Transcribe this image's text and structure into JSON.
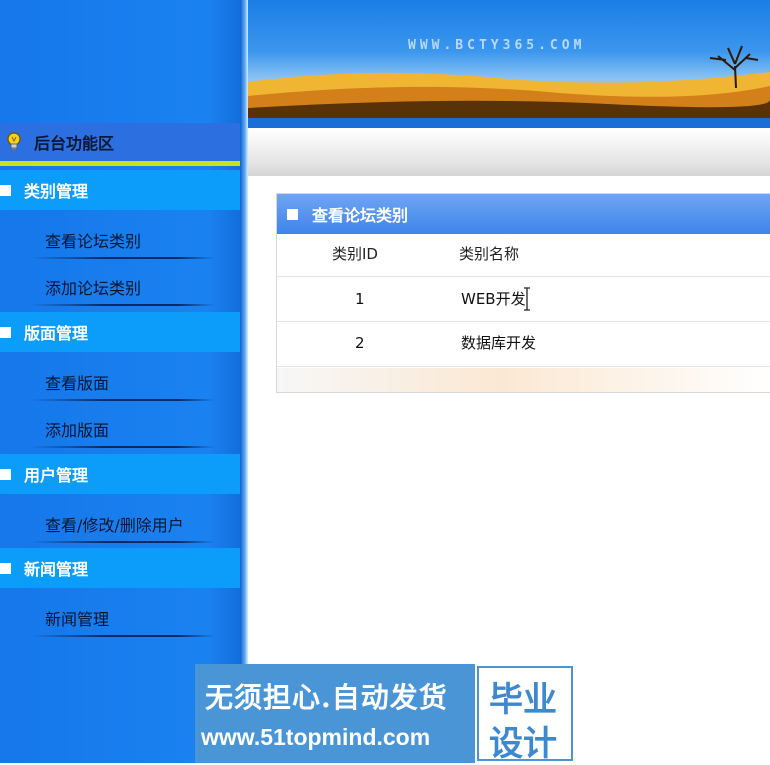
{
  "sidebar": {
    "header_label": "后台功能区",
    "header_icon": "lightbulb-icon",
    "sections": [
      {
        "label": "类别管理",
        "items": [
          "查看论坛类别",
          "添加论坛类别"
        ]
      },
      {
        "label": "版面管理",
        "items": [
          "查看版面",
          "添加版面"
        ]
      },
      {
        "label": "用户管理",
        "items": [
          "查看/修改/删除用户"
        ]
      },
      {
        "label": "新闻管理",
        "items": [
          "新闻管理"
        ]
      }
    ]
  },
  "banner": {
    "url_text": "WWW.BCTY365.COM"
  },
  "panel": {
    "title": "查看论坛类别",
    "columns": [
      "类别ID",
      "类别名称"
    ],
    "rows": [
      {
        "id": "1",
        "name": "WEB开发"
      },
      {
        "id": "2",
        "name": "数据库开发"
      }
    ]
  },
  "watermark": {
    "line1": "无须担心.自动发货",
    "line2": "www.51topmind.com",
    "badge_line1": "毕业",
    "badge_line2": "设计"
  },
  "colors": {
    "sidebar_blue": "#1a82f0",
    "category_blue": "#0b9df9",
    "header_stripe": "#c8e21c",
    "panel_header": "#4a8cee"
  }
}
